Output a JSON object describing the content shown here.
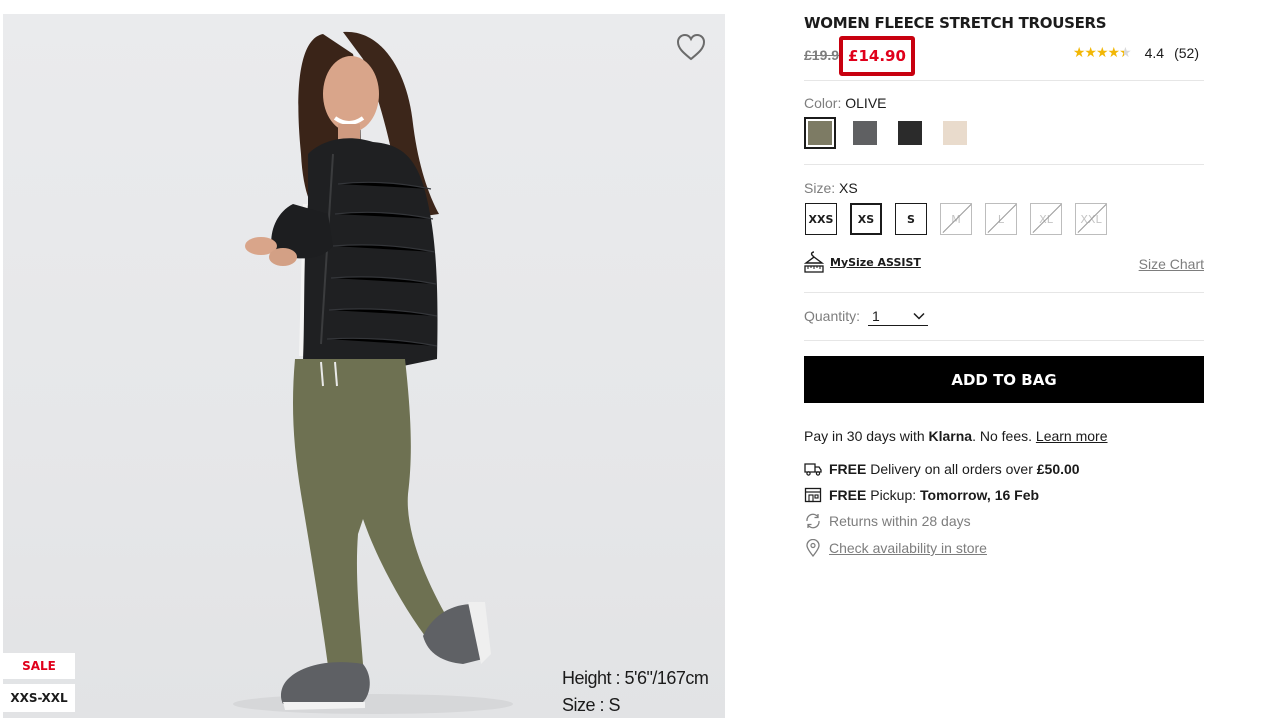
{
  "image": {
    "badges": {
      "sale": "SALE",
      "size_range": "XXS-XXL"
    },
    "model_height": "Height : 5'6\"/167cm",
    "model_size": "Size : S",
    "icons": {
      "wishlist": "heart-outline-icon"
    }
  },
  "product": {
    "title": "WOMEN FLEECE STRETCH TROUSERS",
    "old_price": "£19.90",
    "sale_price": "£14.90",
    "rating_stars": "★★★★★",
    "rating_value": "4.4",
    "review_count": "(52)",
    "rating_fraction": 0.88
  },
  "color": {
    "label": "Color:",
    "selected": "OLIVE",
    "swatches": [
      {
        "name": "olive",
        "hex": "#7d7b64"
      },
      {
        "name": "grey",
        "hex": "#5f6062"
      },
      {
        "name": "black",
        "hex": "#2b2b2b"
      },
      {
        "name": "beige",
        "hex": "#e9dbcc"
      }
    ]
  },
  "size": {
    "label": "Size:",
    "selected": "XS",
    "options": [
      {
        "label": "XXS",
        "available": true
      },
      {
        "label": "XS",
        "available": true,
        "selected": true
      },
      {
        "label": "S",
        "available": true
      },
      {
        "label": "M",
        "available": false
      },
      {
        "label": "L",
        "available": false
      },
      {
        "label": "XL",
        "available": false
      },
      {
        "label": "XXL",
        "available": false
      }
    ],
    "mysize_label": "MySize ASSIST",
    "size_chart_label": "Size Chart"
  },
  "quantity": {
    "label": "Quantity:",
    "value": "1"
  },
  "cta": {
    "add_to_bag": "ADD TO BAG"
  },
  "payment": {
    "prefix": "Pay in 30 days with ",
    "provider": "Klarna",
    "suffix": ". No fees. ",
    "learn_more": "Learn more"
  },
  "services": {
    "delivery_strong": "FREE",
    "delivery_text": " Delivery on all orders over ",
    "delivery_amount": "£50.00",
    "pickup_strong": "FREE",
    "pickup_text": " Pickup: ",
    "pickup_date": "Tomorrow, 16 Feb",
    "returns": "Returns within 28 days",
    "availability": "Check availability in store"
  },
  "colors": {
    "accent_red": "#e0001b",
    "highlight_border": "#c8000f",
    "text": "#1b1b1b",
    "muted": "#7d7d7d"
  }
}
